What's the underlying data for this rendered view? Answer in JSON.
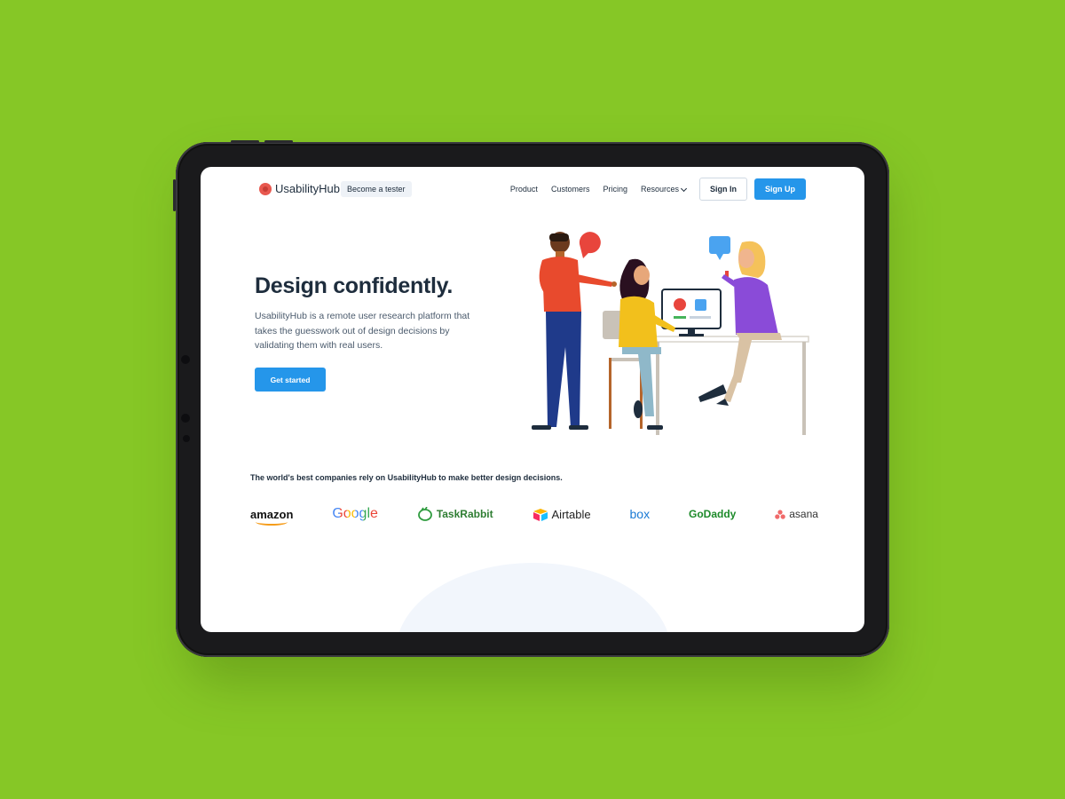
{
  "nav": {
    "brand": "UsabilityHub",
    "tester_pill": "Become a tester",
    "links": [
      "Product",
      "Customers",
      "Pricing",
      "Resources"
    ],
    "sign_in": "Sign In",
    "sign_up": "Sign Up"
  },
  "hero": {
    "title": "Design confidently.",
    "description": "UsabilityHub is a remote user research platform that takes the guesswork out of design decisions by validating them with real users.",
    "cta": "Get started"
  },
  "trust": {
    "heading": "The world's best companies rely on UsabilityHub to make better design decisions.",
    "logos": [
      "amazon",
      "Google",
      "TaskRabbit",
      "Airtable",
      "box",
      "GoDaddy",
      "asana"
    ]
  },
  "colors": {
    "background": "#86c726",
    "primary": "#2596ea",
    "text_dark": "#1e2d3d"
  }
}
